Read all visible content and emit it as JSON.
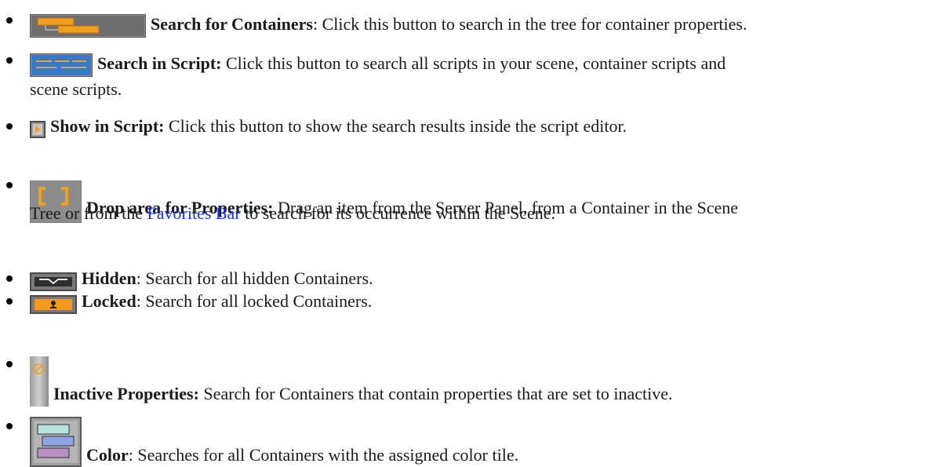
{
  "items": [
    {
      "term": "Search for Containers",
      "sep": ":",
      "desc": " Click this button to search in the tree for container properties.",
      "icon": "search-containers-icon"
    },
    {
      "term": "Search in Script:",
      "sep": "",
      "desc": " Click this button to search all scripts in your scene, container scripts and",
      "desc2": "scene scripts.",
      "icon": "search-in-script-icon"
    },
    {
      "term": "Show in Script:",
      "sep": "",
      "desc": " Click this button to show the search results inside the script editor.",
      "icon": "show-in-script-icon"
    },
    {
      "term": "Drop area for Properties:",
      "sep": "",
      "desc": " Drag an item from the Server Panel, from a Container in the Scene",
      "desc2_pre": "Tree or from the ",
      "link": "Favorites Bar",
      "desc2_post": " to search for its occurrence within the Scene.",
      "icon": "drop-area-icon"
    },
    {
      "term": "Hidden",
      "sep": ":",
      "desc": " Search for all hidden Containers.",
      "icon": "hidden-icon"
    },
    {
      "term": "Locked",
      "sep": ":",
      "desc": " Search for all locked Containers.",
      "icon": "locked-icon"
    },
    {
      "term": "Inactive Properties:",
      "sep": "",
      "desc": " Search for Containers that contain properties that are set to inactive.",
      "icon": "inactive-properties-icon"
    },
    {
      "term": "Color",
      "sep": ":",
      "desc": " Searches for all Containers with the assigned color tile.",
      "icon": "color-icon"
    }
  ],
  "colors": {
    "link": "#1a33e6",
    "text": "#1a1a1a",
    "locked_orange": "#f59a1c"
  }
}
